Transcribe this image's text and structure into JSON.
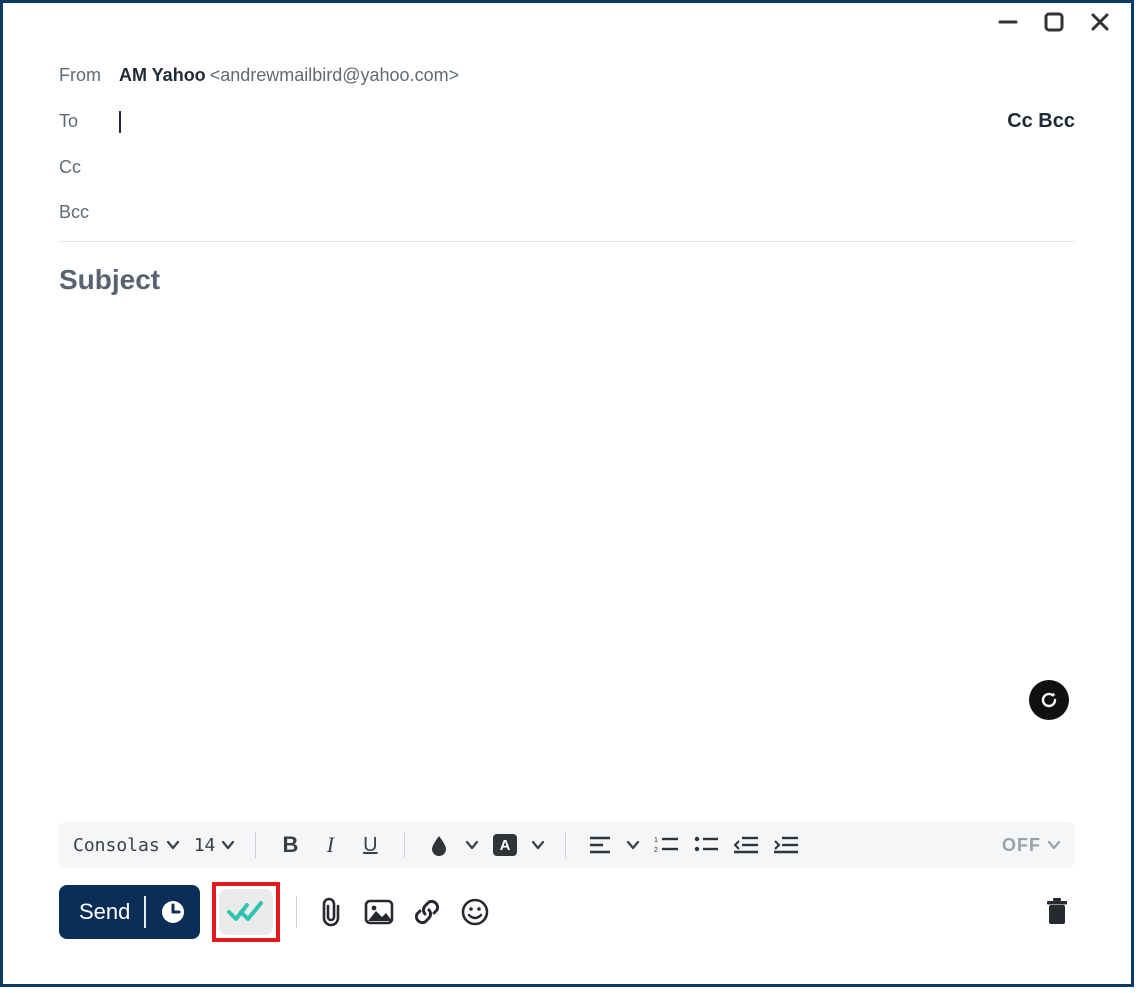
{
  "window_controls": {
    "minimize": "minimize",
    "maximize": "maximize",
    "close": "close"
  },
  "compose": {
    "from_label": "From",
    "account_name": "AM Yahoo",
    "account_email": "<andrewmailbird@yahoo.com>",
    "to_label": "To",
    "to_value": "",
    "ccbcc_toggle_label": "Cc Bcc",
    "cc_label": "Cc",
    "bcc_label": "Bcc",
    "subject_placeholder": "Subject"
  },
  "format_toolbar": {
    "font_name": "Consolas",
    "font_size": "14",
    "tracking_indicator": "OFF"
  },
  "actions": {
    "send_label": "Send"
  }
}
